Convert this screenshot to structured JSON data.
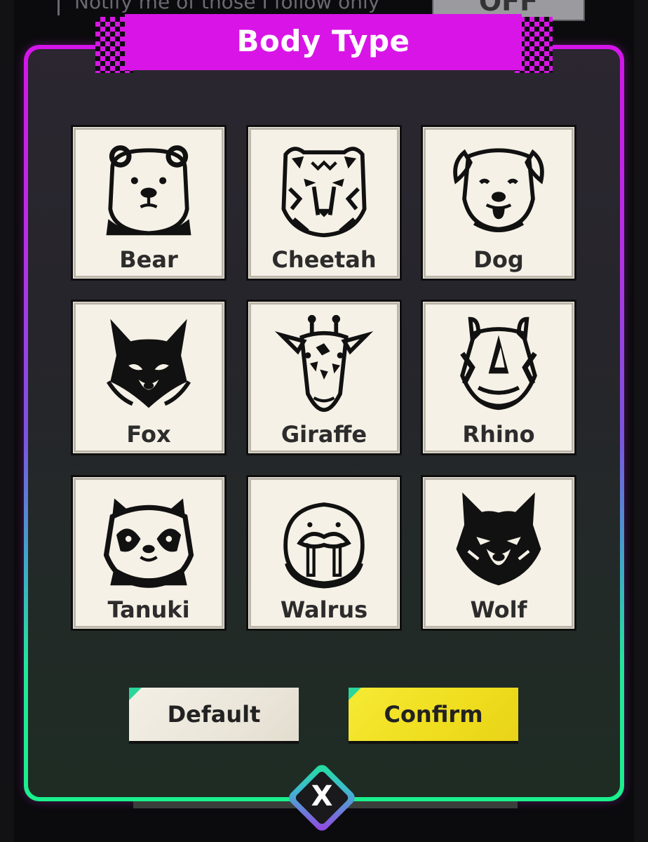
{
  "background": {
    "notify_text": "Notify me of those I follow only",
    "toggle_label": "OFF"
  },
  "dialog": {
    "title": "Body Type",
    "options": [
      {
        "label": "Bear",
        "icon": "bear-icon"
      },
      {
        "label": "Cheetah",
        "icon": "cheetah-icon"
      },
      {
        "label": "Dog",
        "icon": "dog-icon"
      },
      {
        "label": "Fox",
        "icon": "fox-icon"
      },
      {
        "label": "Giraffe",
        "icon": "giraffe-icon"
      },
      {
        "label": "Rhino",
        "icon": "rhino-icon"
      },
      {
        "label": "Tanuki",
        "icon": "tanuki-icon"
      },
      {
        "label": "Walrus",
        "icon": "walrus-icon"
      },
      {
        "label": "Wolf",
        "icon": "wolf-icon"
      }
    ],
    "default_label": "Default",
    "confirm_label": "Confirm",
    "close_label": "X"
  },
  "colors": {
    "accent_magenta": "#d815e6",
    "accent_green": "#1af08b",
    "confirm_yellow": "#f2e124",
    "card_bg": "#f6f1e6"
  }
}
